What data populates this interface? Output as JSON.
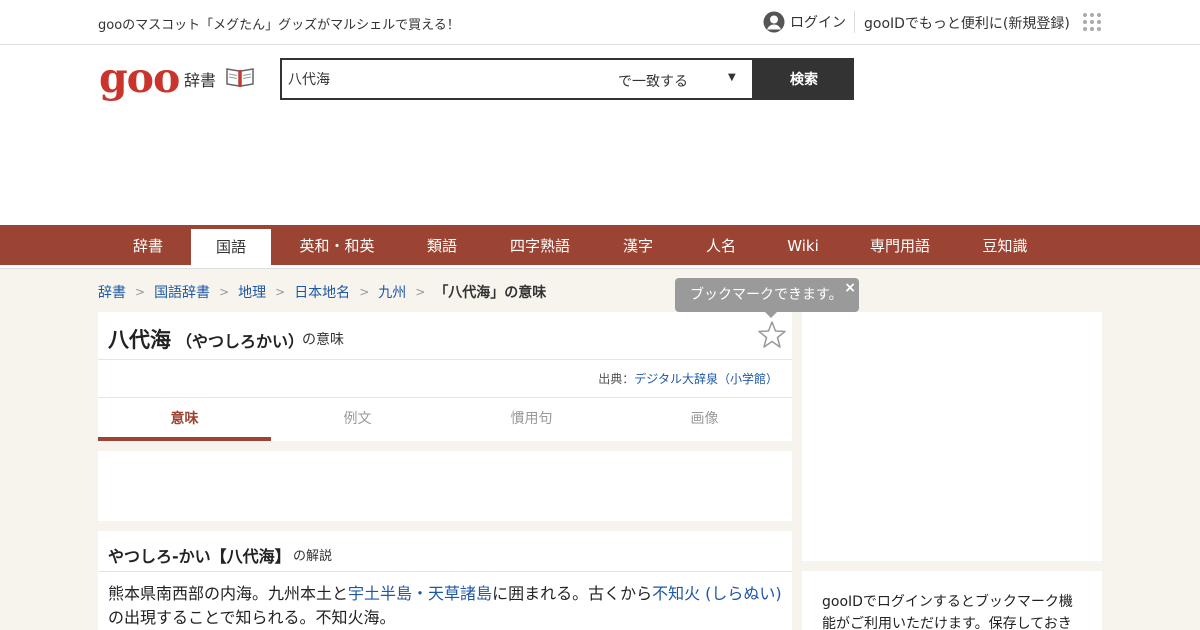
{
  "topbar": {
    "promo": "gooのマスコット「メグたん」グッズがマルシェルで買える！",
    "login": "ログイン",
    "register": "gooIDでもっと便利に(新規登録)"
  },
  "header": {
    "logo": "goo",
    "dict_label": "辞書",
    "search_value": "八代海",
    "search_mode": "で一致する",
    "search_button": "検索"
  },
  "nav": {
    "items": [
      "辞書",
      "国語",
      "英和・和英",
      "類語",
      "四字熟語",
      "漢字",
      "人名",
      "Wiki",
      "専門用語",
      "豆知識"
    ],
    "active_index": 1
  },
  "breadcrumb": {
    "items": [
      "辞書",
      "国語辞書",
      "地理",
      "日本地名",
      "九州"
    ],
    "current": "「八代海」の意味"
  },
  "tooltip": {
    "text": "ブックマークできます。",
    "close": "×"
  },
  "entry": {
    "word": "八代海",
    "reading": "（やつしろかい）",
    "meaning_suffix": "の意味",
    "source_prefix": "出典：",
    "source_name": "デジタル大辞泉（小学館）",
    "tabs": [
      "意味",
      "例文",
      "慣用句",
      "画像"
    ]
  },
  "definition": {
    "title": "やつしろ-かい【八代海】",
    "suffix": "の解説",
    "text_1": "熊本県南西部の内海。九州本土と",
    "link_1": "宇土半島",
    "text_2": "・",
    "link_2": "天草諸島",
    "text_3": "に囲まれる。古くから",
    "link_3": "不知火 (しらぬい)",
    "text_4": "の出現することで知られる。不知火海。"
  },
  "sidebar": {
    "text": "gooIDでログインするとブックマーク機能がご利用いただけます。保存しておき"
  },
  "colors": {
    "brand": "#c9342c",
    "nav_bg": "#9b4433",
    "link": "#1e57a6"
  }
}
